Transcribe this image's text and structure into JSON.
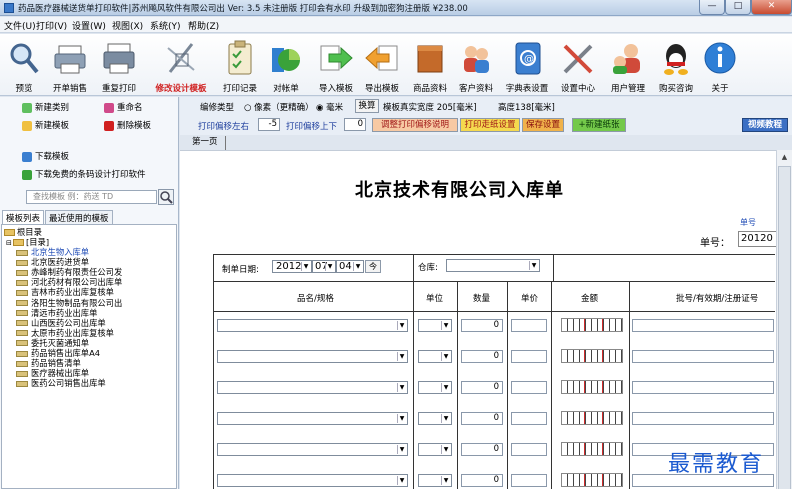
{
  "window": {
    "title": "药品医疗器械送货单打印软件|苏州飚风软件有限公司出  Ver: 3.5  未注册版 打印会有水印    升级到加密狗注册版 ¥238.00",
    "min": "—",
    "max": "□",
    "close": "✕"
  },
  "menu": [
    "文件(U)",
    "打印(V)",
    "设置(W)",
    "视图(X)",
    "系统(Y)",
    "帮助(Z)"
  ],
  "toolbar": [
    {
      "label": "预览",
      "icon": "magnifier-icon",
      "color": "#6a8fb8"
    },
    {
      "label": "开单销售",
      "icon": "printer-icon",
      "color": "#7d8fa6"
    },
    {
      "label": "重复打印",
      "icon": "printer-icon",
      "color": "#6e7f96"
    },
    {
      "label": "修改设计模板",
      "icon": "design-tools-icon",
      "color": "#8a9ab0",
      "highlight": true
    },
    {
      "label": "打印记录",
      "icon": "clipboard-icon",
      "color": "#c8b680"
    },
    {
      "label": "对帐单",
      "icon": "pie-chart-icon",
      "color": "#3aa23a"
    },
    {
      "label": "导入模板",
      "icon": "arrow-right-icon",
      "color": "#4fbf4f"
    },
    {
      "label": "导出模板",
      "icon": "arrow-left-icon",
      "color": "#f0a030"
    },
    {
      "label": "商品资料",
      "icon": "box-icon",
      "color": "#c46a2a"
    },
    {
      "label": "客户资料",
      "icon": "users-icon",
      "color": "#d98a4a"
    },
    {
      "label": "字典表设置",
      "icon": "address-book-icon",
      "color": "#3b7fd0"
    },
    {
      "label": "设置中心",
      "icon": "tools-icon",
      "color": "#888f99"
    },
    {
      "label": "用户管理",
      "icon": "user-manage-icon",
      "color": "#d04a3a"
    },
    {
      "label": "购买咨询",
      "icon": "qq-icon",
      "color": "#222222"
    },
    {
      "label": "关于",
      "icon": "info-icon",
      "color": "#2f7fd6"
    }
  ],
  "left": {
    "new_category": "新建类别",
    "rename": "重命名",
    "new_template": "新建模板",
    "delete_template": "删除模板",
    "download_template": "下载模板",
    "download_free": "下载免费的条码设计打印软件",
    "search_placeholder": "查找模板 例：药送 TD",
    "tabs": [
      "模板列表",
      "最近使用的模板"
    ],
    "tree_root": "根目录",
    "tree_dir": "[目录]",
    "tree_items": [
      "北京生物入库单",
      "北京医药进货单",
      "赤峰制药有限责任公司发",
      "河北药材有限公司出库单",
      "吉林市药业出库复核单",
      "洛阳生物制品有限公司出",
      "清远市药业出库单",
      "山西医药公司出库单",
      "太原市药业出库复核单",
      "委托灭菌通知单",
      "药品销售出库单A4",
      "药品销售清单",
      "医疗器械出库单",
      "医药公司销售出库单"
    ]
  },
  "options": {
    "edit_type": "编修类型",
    "radio_pixel": "○ 像素（更精确）",
    "radio_mm": "◉ 毫米",
    "convert": "换算",
    "real_width_label": "模板真实宽度 205[毫米]",
    "height_label": "高度138[毫米]",
    "offset_lr_label": "打印偏移左右",
    "offset_lr": "-5",
    "offset_ud_label": "打印偏移上下",
    "offset_ud": "0",
    "adjust_btn": "调整打印偏移说明",
    "paper_btn": "打印走纸设置",
    "save_btn": "保存设置",
    "new_paper_btn": "+新建纸张",
    "video_btn": "视频教程",
    "page_tab": "第一页"
  },
  "doc": {
    "title": "北京技术有限公司入库单",
    "no_blue": "单号",
    "no_label": "单号：",
    "no_value": "20120",
    "date_label": "制单日期:",
    "year": "2012",
    "month": "07",
    "day": "04",
    "today": "今",
    "warehouse_label": "仓库:",
    "headers": [
      "品名/规格",
      "单位",
      "数量",
      "单价",
      "金额",
      "批号/有效期/注册证号"
    ],
    "row_qty": [
      "0",
      "0",
      "0",
      "0",
      "0",
      "0"
    ]
  },
  "watermark": "最需教育"
}
